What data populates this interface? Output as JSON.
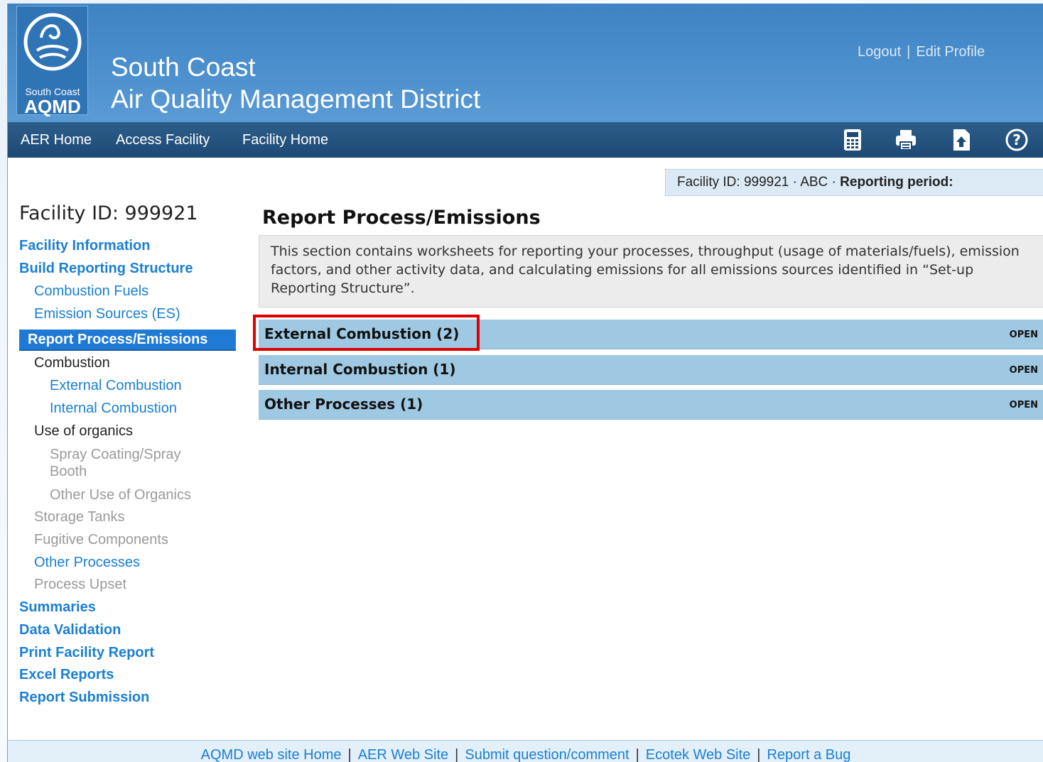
{
  "header": {
    "logo_small_text": "South Coast",
    "logo_big_text": "AQMD",
    "title_line1": "South Coast",
    "title_line2": "Air Quality Management District",
    "logout_label": "Logout",
    "separator": "|",
    "edit_profile_label": "Edit Profile"
  },
  "nav": {
    "items": [
      {
        "label": "AER Home"
      },
      {
        "label": "Access Facility"
      },
      {
        "label": "Facility Home"
      }
    ],
    "icons": [
      "calculator-icon",
      "printer-icon",
      "upload-icon",
      "help-icon"
    ]
  },
  "facility_bar": {
    "prefix": "Facility ID: 999921 · ABC · ",
    "period_label": "Reporting period:"
  },
  "sidebar": {
    "title": "Facility ID: 999921",
    "facility_information": "Facility Information",
    "build_reporting_structure": "Build Reporting Structure",
    "combustion_fuels": "Combustion Fuels",
    "emission_sources": "Emission Sources (ES)",
    "report_process_emissions": "Report Process/Emissions",
    "combustion": "Combustion",
    "external_combustion": "External Combustion",
    "internal_combustion": "Internal Combustion",
    "use_of_organics": "Use of organics",
    "spray_coating": "Spray Coating/Spray Booth",
    "other_use_of_organics": "Other Use of Organics",
    "storage_tanks": "Storage Tanks",
    "fugitive_components": "Fugitive Components",
    "other_processes": "Other Processes",
    "process_upset": "Process Upset",
    "summaries": "Summaries",
    "data_validation": "Data Validation",
    "print_facility_report": "Print Facility Report",
    "excel_reports": "Excel Reports",
    "report_submission": "Report Submission"
  },
  "main": {
    "title": "Report Process/Emissions",
    "description": "This section contains worksheets for reporting your processes, throughput (usage of materials/fuels), emission factors, and other activity data, and calculating emissions for all emissions sources identified in “Set-up Reporting Structure”.",
    "sections": [
      {
        "label": "External Combustion (2)",
        "action": "OPEN"
      },
      {
        "label": "Internal Combustion (1)",
        "action": "OPEN"
      },
      {
        "label": "Other Processes (1)",
        "action": "OPEN"
      }
    ]
  },
  "footer": {
    "links": [
      {
        "label": "AQMD web site Home"
      },
      {
        "label": "AER Web Site"
      },
      {
        "label": "Submit question/comment"
      },
      {
        "label": "Ecotek Web Site"
      },
      {
        "label": "Report a Bug"
      }
    ],
    "separator": "|"
  },
  "colors": {
    "header_blue": "#4b8fcd",
    "nav_dark": "#1d4a75",
    "link_blue": "#1a7fd4",
    "accordion_blue": "#9fc8e3",
    "highlight_red": "#e00000"
  }
}
